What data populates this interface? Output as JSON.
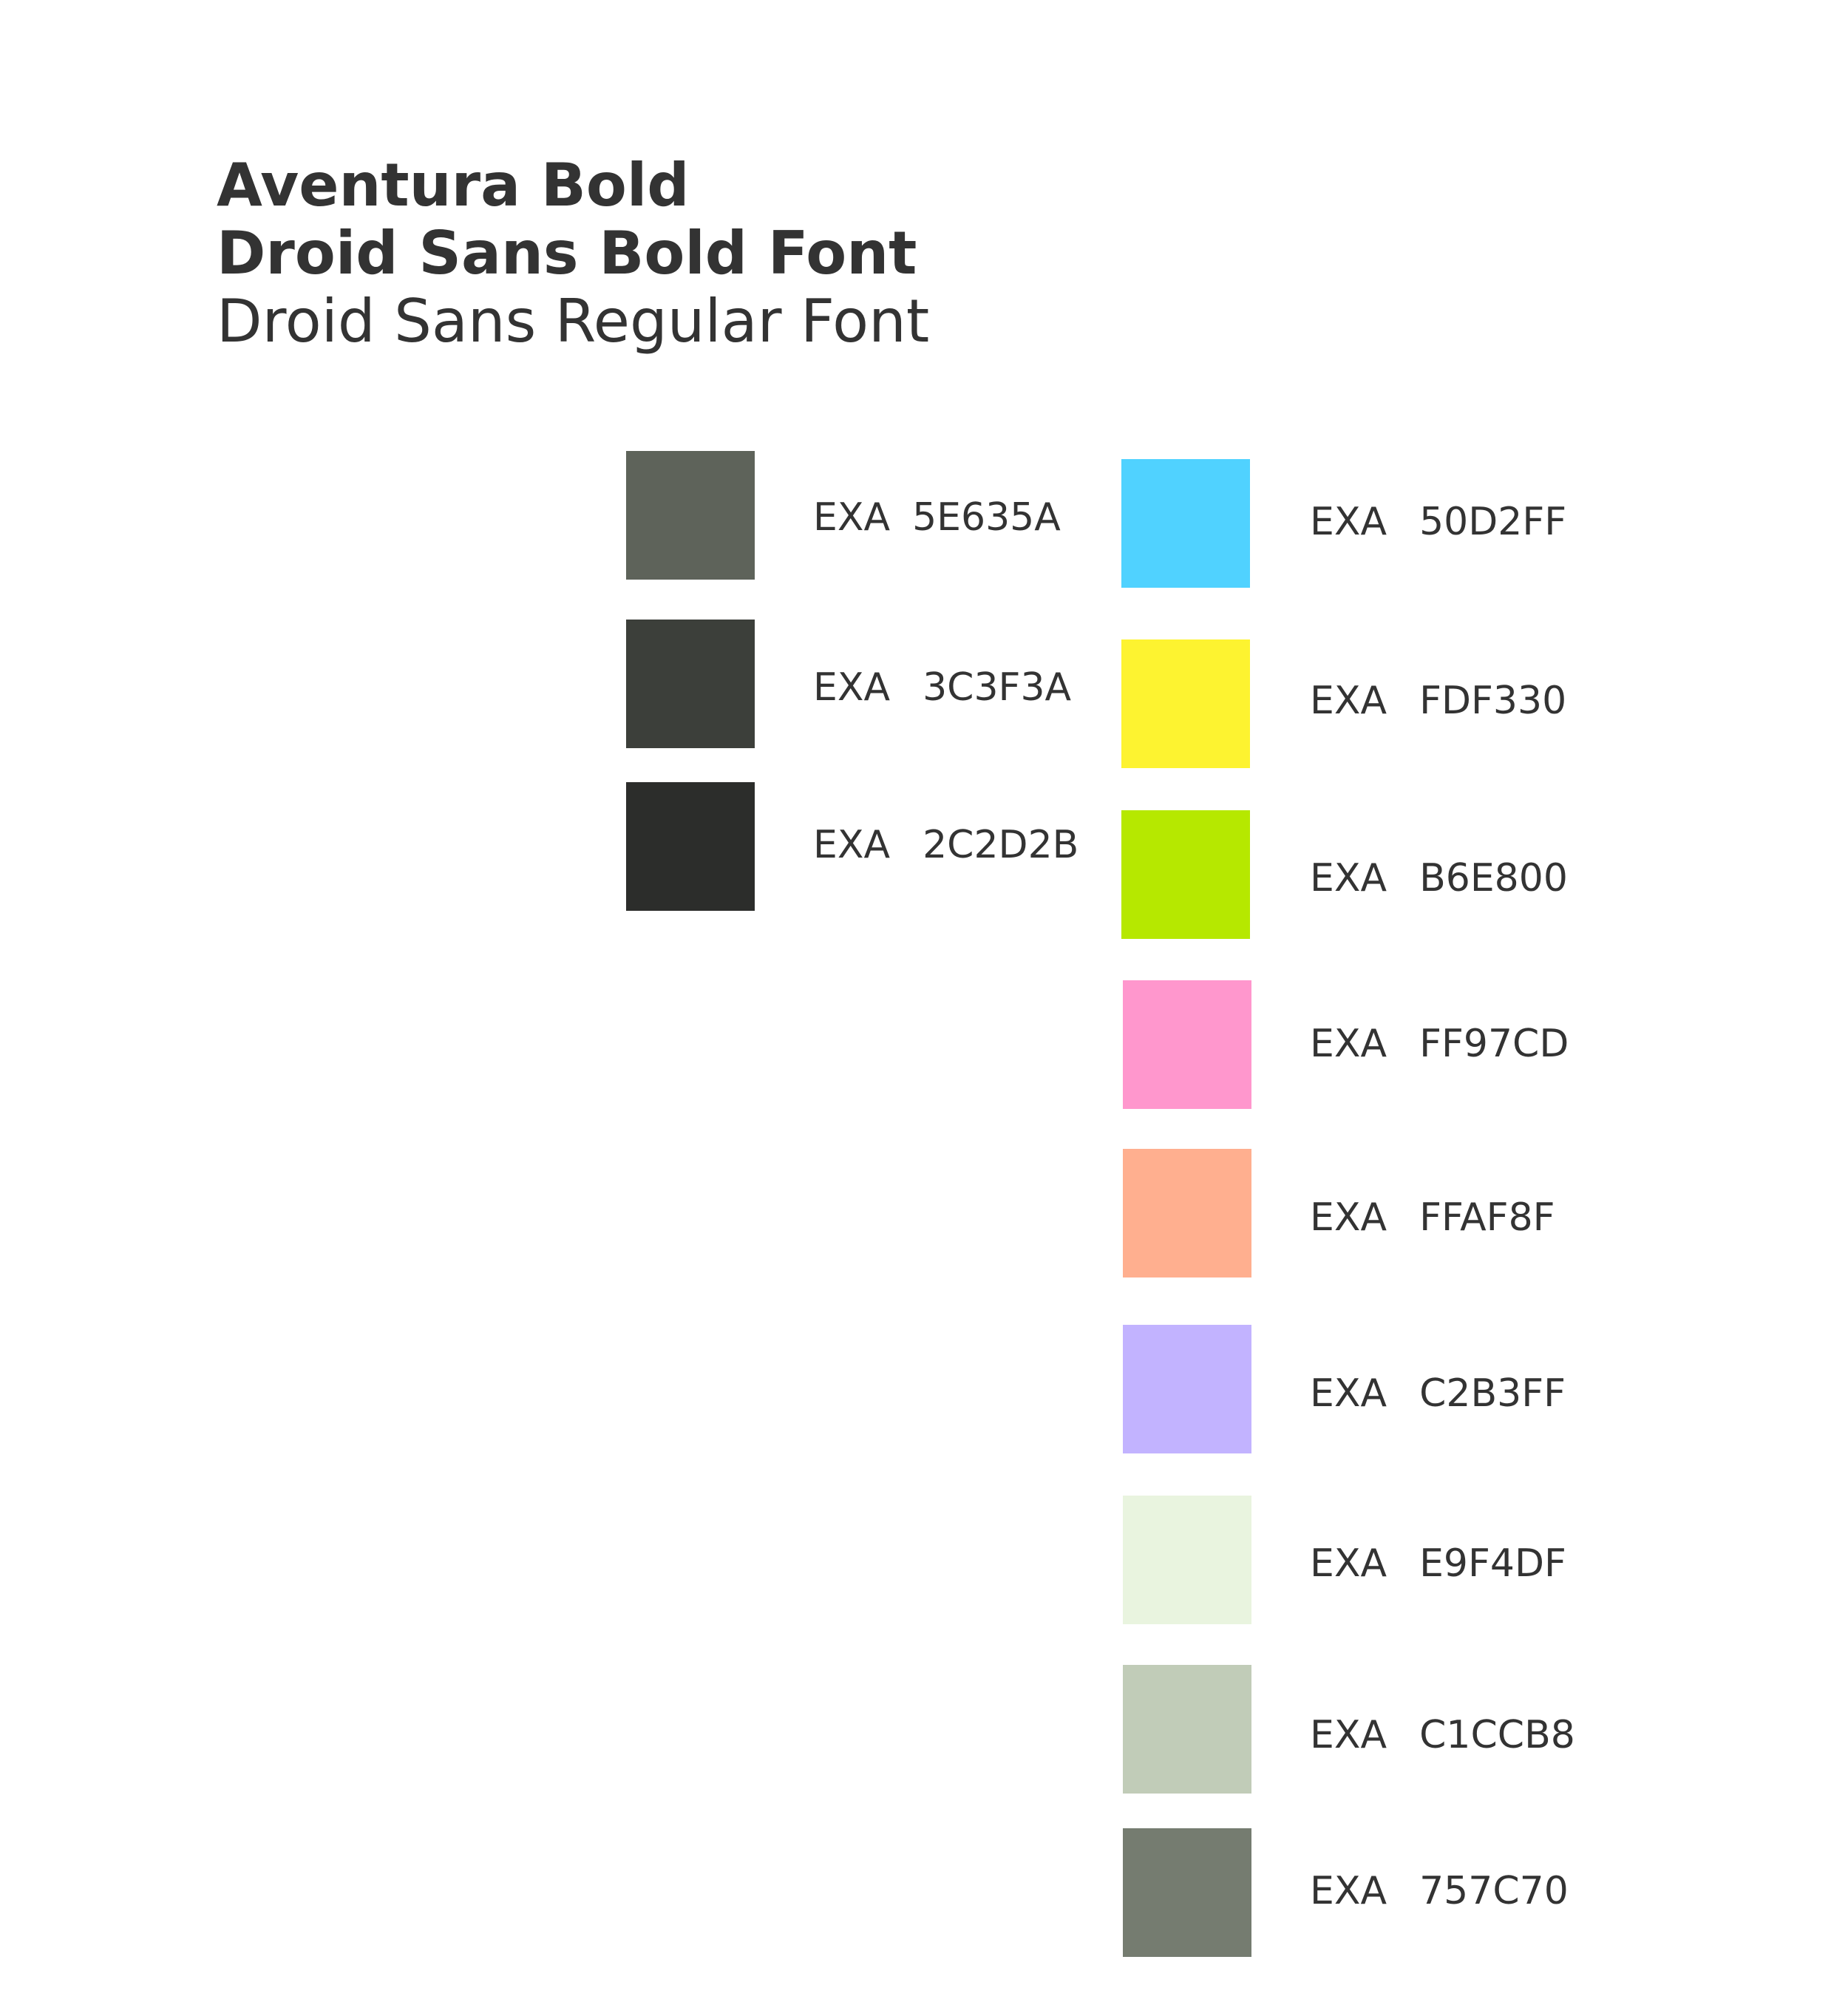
{
  "fonts": {
    "line1": "Aventura Bold",
    "line2": "Droid Sans Bold Font",
    "line3": "Droid Sans Regular Font"
  },
  "palette_left": [
    {
      "prefix": "EXA",
      "code": "5E635A",
      "color": "#5E635A"
    },
    {
      "prefix": "EXA",
      "code": "3C3F3A",
      "color": "#3C3F3A"
    },
    {
      "prefix": "EXA",
      "code": "2C2D2B",
      "color": "#2C2D2B"
    }
  ],
  "palette_right": [
    {
      "prefix": "EXA",
      "code": "50D2FF",
      "color": "#50D2FF"
    },
    {
      "prefix": "EXA",
      "code": "FDF330",
      "color": "#FDF330"
    },
    {
      "prefix": "EXA",
      "code": "B6E800",
      "color": "#B6E800"
    },
    {
      "prefix": "EXA",
      "code": "FF97CD",
      "color": "#FF97CD"
    },
    {
      "prefix": "EXA",
      "code": "FFAF8F",
      "color": "#FFAF8F"
    },
    {
      "prefix": "EXA",
      "code": "C2B3FF",
      "color": "#C2B3FF"
    },
    {
      "prefix": "EXA",
      "code": "E9F4DF",
      "color": "#E9F4DF"
    },
    {
      "prefix": "EXA",
      "code": "C1CCB8",
      "color": "#C1CCB8"
    },
    {
      "prefix": "EXA",
      "code": "757C70",
      "color": "#757C70"
    }
  ]
}
